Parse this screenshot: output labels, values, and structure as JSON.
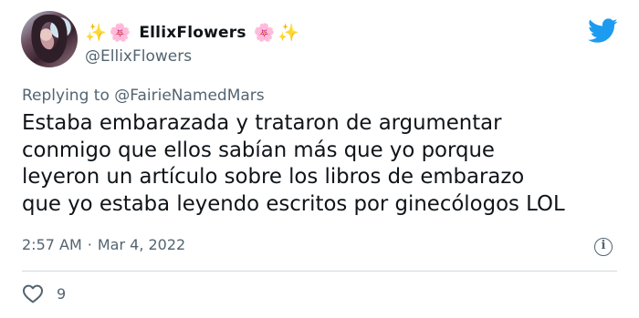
{
  "user": {
    "display_name": "EllixFlowers",
    "name_prefix_emoji": [
      "✨",
      "🌸"
    ],
    "name_suffix_emoji": [
      "🌸",
      "✨"
    ],
    "handle": "@EllixFlowers"
  },
  "reply": {
    "prefix": "Replying to",
    "mention": "@FairieNamedMars"
  },
  "tweet": {
    "lines": [
      "Estaba embarazada y trataron de argumentar",
      "conmigo que ellos sabían más que yo porque",
      "leyeron un artículo sobre los libros de embarazo",
      "que yo estaba leyendo escritos por ginecólogos LOL"
    ]
  },
  "meta": {
    "time": "2:57 AM",
    "separator": "·",
    "date": "Mar 4, 2022"
  },
  "engagement": {
    "likes": "9"
  },
  "icons": {
    "brand": "twitter-bird-icon",
    "info": "info-icon",
    "like": "heart-icon"
  },
  "colors": {
    "brand": "#1d9bf0",
    "text": "#0f1419",
    "muted": "#536471",
    "divider": "#cfd9de"
  }
}
